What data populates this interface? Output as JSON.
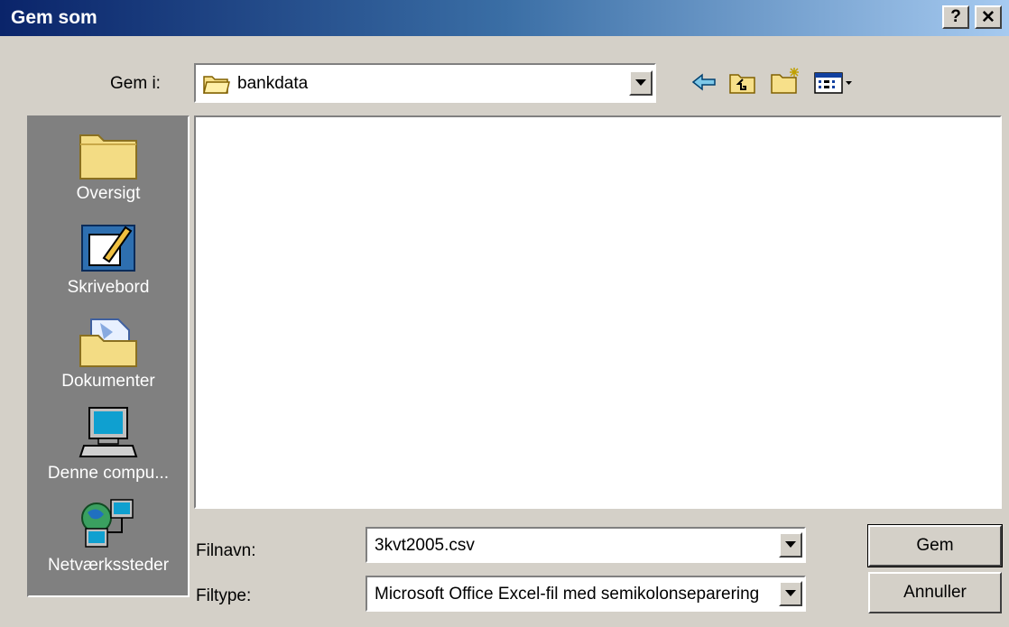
{
  "window": {
    "title": "Gem som",
    "help_label": "?",
    "close_label": "✕"
  },
  "save_in": {
    "label": "Gem i:",
    "value": "bankdata"
  },
  "places": [
    {
      "label": "Oversigt",
      "icon": "folder-icon"
    },
    {
      "label": "Skrivebord",
      "icon": "desktop-icon"
    },
    {
      "label": "Dokumenter",
      "icon": "documents-icon"
    },
    {
      "label": "Denne compu...",
      "icon": "computer-icon"
    },
    {
      "label": "Netværkssteder",
      "icon": "network-icon"
    }
  ],
  "filename": {
    "label": "Filnavn:",
    "value": "3kvt2005.csv"
  },
  "filetype": {
    "label": "Filtype:",
    "value": "Microsoft Office Excel-fil med semikolonseparering"
  },
  "buttons": {
    "save": "Gem",
    "cancel": "Annuller"
  },
  "toolbar_icons": [
    "back-arrow-icon",
    "up-folder-icon",
    "new-folder-icon",
    "view-menu-icon"
  ]
}
